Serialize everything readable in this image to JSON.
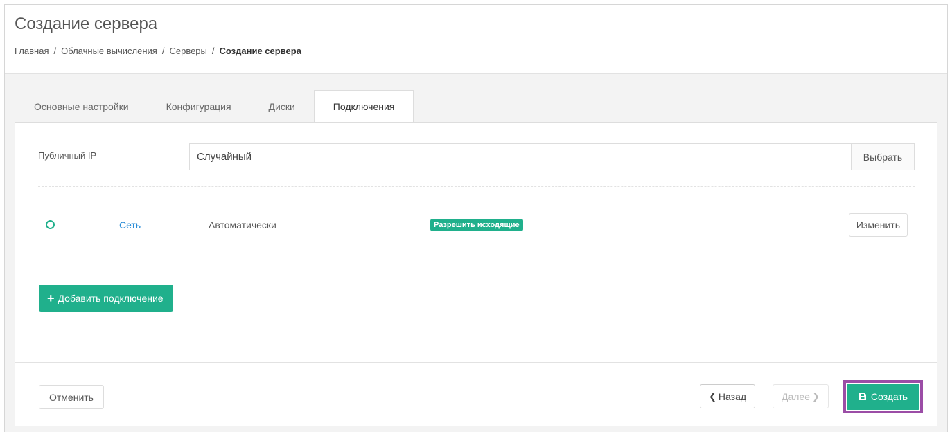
{
  "header": {
    "title": "Создание сервера",
    "breadcrumb": [
      "Главная",
      "Облачные вычисления",
      "Серверы",
      "Создание сервера"
    ],
    "separator": "/"
  },
  "tabs": [
    {
      "label": "Основные настройки",
      "active": false
    },
    {
      "label": "Конфигурация",
      "active": false
    },
    {
      "label": "Диски",
      "active": false
    },
    {
      "label": "Подключения",
      "active": true
    }
  ],
  "public_ip": {
    "label": "Публичный IP",
    "value": "Случайный",
    "select_label": "Выбрать"
  },
  "connection": {
    "network_label": "Сеть",
    "assignment": "Автоматически",
    "badge": "Разрешить исходящие",
    "change_label": "Изменить"
  },
  "add_connection": {
    "icon": "+",
    "label": "Добавить подключение"
  },
  "footer": {
    "cancel_label": "Отменить",
    "back_label": "Назад",
    "next_label": "Далее",
    "create_label": "Создать"
  },
  "colors": {
    "accent": "#20b08c",
    "link": "#2a8cd6",
    "highlight": "#9b4da6"
  }
}
